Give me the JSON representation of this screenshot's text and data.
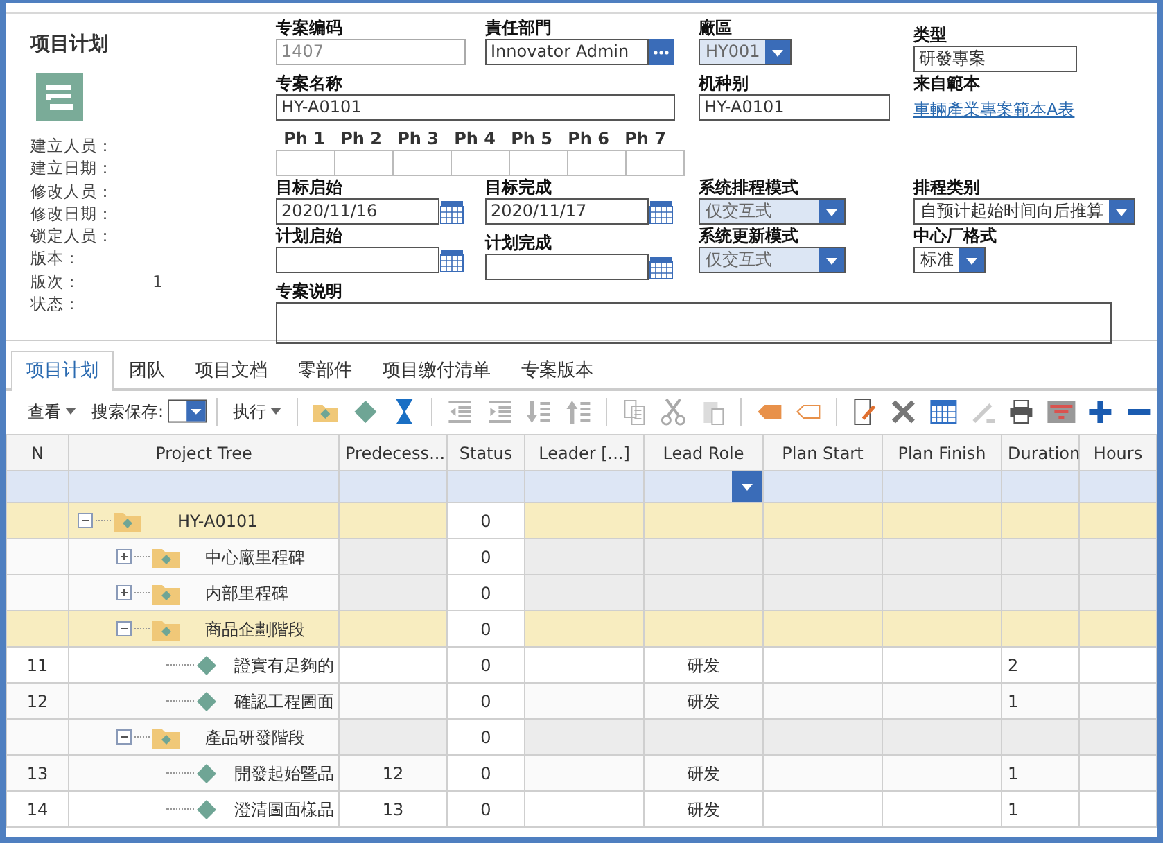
{
  "summary": {
    "title": "项目计划",
    "meta": [
      {
        "label": "建立人员："
      },
      {
        "label": "建立日期："
      },
      {
        "label": "修改人员："
      },
      {
        "label": "修改日期："
      },
      {
        "label": "锁定人员："
      },
      {
        "label": "版本："
      },
      {
        "label": "版次：",
        "value": "1"
      },
      {
        "label": "状态："
      }
    ]
  },
  "form": {
    "fields": [
      {
        "kind": "text",
        "label": "专案编码",
        "value": "1407",
        "disabled": true
      },
      {
        "kind": "lookup",
        "label": "責任部門",
        "value": "Innovator Admin",
        "disabled": false
      },
      {
        "kind": "select",
        "label": "廠區",
        "value": "HY001",
        "disabled": true
      },
      {
        "kind": "text",
        "label": "类型",
        "value": "研發專案",
        "disabled": false
      },
      {
        "kind": "text",
        "label": "专案名称",
        "value": "HY-A0101",
        "disabled": false
      },
      {
        "kind": "text",
        "label": "机种别",
        "value": "HY-A0101",
        "disabled": false
      },
      {
        "kind": "link",
        "label": "来自範本",
        "value": "車輛產業專案範本A表"
      },
      {
        "kind": "phases",
        "labels": [
          "Ph 1",
          "Ph 2",
          "Ph 3",
          "Ph 4",
          "Ph 5",
          "Ph 6",
          "Ph 7"
        ]
      },
      {
        "kind": "date",
        "label": "目标启始",
        "value": "2020/11/16",
        "disabled": false
      },
      {
        "kind": "date",
        "label": "目标完成",
        "value": "2020/11/17",
        "disabled": false
      },
      {
        "kind": "select",
        "label": "系统排程模式",
        "value": "仅交互式",
        "disabled": true
      },
      {
        "kind": "select",
        "label": "排程类别",
        "value": "自预计起始时间向后推算",
        "disabled": false
      },
      {
        "kind": "date",
        "label": "计划启始",
        "disabled": false
      },
      {
        "kind": "date",
        "label": "计划完成",
        "disabled": false
      },
      {
        "kind": "select",
        "label": "系统更新模式",
        "value": "仅交互式",
        "disabled": true
      },
      {
        "kind": "select",
        "label": "中心厂格式",
        "value": "标准",
        "disabled": false
      },
      {
        "kind": "textarea",
        "label": "专案说明"
      }
    ]
  },
  "tabs": [
    {
      "label": "项目计划",
      "selected": true
    },
    {
      "label": "团队",
      "selected": false
    },
    {
      "label": "项目文档",
      "selected": false
    },
    {
      "label": "零部件",
      "selected": false
    },
    {
      "label": "项目缴付清单",
      "selected": false
    },
    {
      "label": "专案版本",
      "selected": false
    }
  ],
  "toolbar": {
    "menus": [
      {
        "kind": "menu",
        "label": "查看"
      },
      {
        "kind": "select",
        "label": "搜索保存:"
      },
      {
        "kind": "menu",
        "label": "执行"
      }
    ],
    "icon_groups": [
      [
        {
          "kind": "folder",
          "disabled": false
        },
        {
          "kind": "diamond",
          "disabled": false
        },
        {
          "kind": "hourglass",
          "disabled": false
        }
      ],
      [
        {
          "kind": "outdent",
          "disabled": true
        },
        {
          "kind": "indent",
          "disabled": true
        },
        {
          "kind": "move-down",
          "disabled": true
        },
        {
          "kind": "move-up",
          "disabled": true
        }
      ],
      [
        {
          "kind": "copy",
          "disabled": true
        },
        {
          "kind": "cut",
          "disabled": true
        },
        {
          "kind": "paste",
          "disabled": true
        }
      ],
      [
        {
          "kind": "tag-filled",
          "disabled": false
        },
        {
          "kind": "tag-outline",
          "disabled": false
        }
      ],
      [
        {
          "kind": "edit",
          "disabled": false
        },
        {
          "kind": "delete",
          "disabled": false
        },
        {
          "kind": "calendar",
          "disabled": false
        },
        {
          "kind": "pen",
          "disabled": true
        },
        {
          "kind": "print",
          "disabled": false
        },
        {
          "kind": "filter",
          "disabled": false
        },
        {
          "kind": "add",
          "disabled": false
        },
        {
          "kind": "remove",
          "disabled": false
        }
      ]
    ]
  },
  "grid": {
    "columns": [
      {
        "label": "N",
        "filter_dropdown": false
      },
      {
        "label": "Project Tree",
        "filter_dropdown": false
      },
      {
        "label": "Predecess...",
        "filter_dropdown": false
      },
      {
        "label": "Status",
        "filter_dropdown": false
      },
      {
        "label": "Leader [...]",
        "filter_dropdown": false
      },
      {
        "label": "Lead Role",
        "filter_dropdown": true
      },
      {
        "label": "Plan Start",
        "filter_dropdown": false
      },
      {
        "label": "Plan Finish",
        "filter_dropdown": false
      },
      {
        "label": "Duration",
        "filter_dropdown": false
      },
      {
        "label": "Hours",
        "filter_dropdown": false
      }
    ],
    "rows": [
      {
        "kind": "summary",
        "name": "HY-A0101",
        "status": "0",
        "highlighted": true,
        "expanded": true,
        "children": [
          {
            "kind": "summary",
            "name": "中心廠里程碑",
            "status": "0",
            "highlighted": false,
            "expanded": false
          },
          {
            "kind": "summary",
            "name": "内部里程碑",
            "status": "0",
            "highlighted": false,
            "expanded": false
          },
          {
            "kind": "summary",
            "name": "商品企劃階段",
            "status": "0",
            "highlighted": true,
            "expanded": true,
            "children": [
              {
                "kind": "task",
                "n": "11",
                "name": "證實有足夠的",
                "status": "0",
                "lead_role": "研发",
                "duration": "2"
              },
              {
                "kind": "task",
                "n": "12",
                "name": "確認工程圖面",
                "status": "0",
                "lead_role": "研发",
                "duration": "1"
              }
            ]
          },
          {
            "kind": "summary",
            "name": "產品研發階段",
            "status": "0",
            "highlighted": false,
            "expanded": true,
            "children": [
              {
                "kind": "task",
                "n": "13",
                "name": "開發起始暨品",
                "predecessors": "12",
                "status": "0",
                "lead_role": "研发",
                "duration": "1"
              },
              {
                "kind": "task",
                "n": "14",
                "name": "澄清圖面樣品",
                "predecessors": "13",
                "status": "0",
                "lead_role": "研发",
                "duration": "1"
              }
            ]
          }
        ]
      }
    ]
  }
}
